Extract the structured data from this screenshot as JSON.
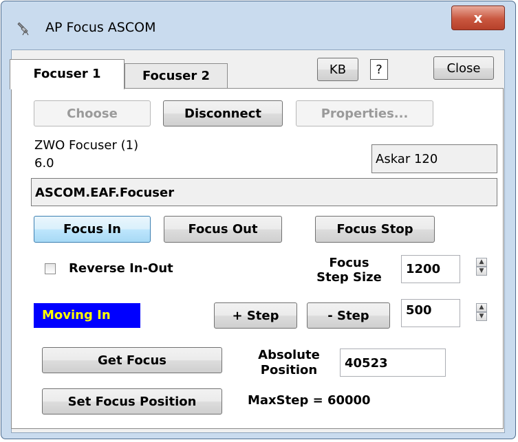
{
  "window": {
    "title": "AP Focus ASCOM",
    "close_glyph": "x"
  },
  "tabs": [
    {
      "label": "Focuser 1",
      "active": true
    },
    {
      "label": "Focuser 2",
      "active": false
    }
  ],
  "toolbar": {
    "kb_label": "KB",
    "help_label": "?",
    "close_label": "Close"
  },
  "connection": {
    "choose_label": "Choose",
    "disconnect_label": "Disconnect",
    "properties_label": "Properties...",
    "device_name": "ZWO Focuser (1)",
    "driver_version": "6.0",
    "telescope_name": "Askar 120",
    "driver_id": "ASCOM.EAF.Focuser"
  },
  "motion": {
    "focus_in_label": "Focus In",
    "focus_out_label": "Focus Out",
    "focus_stop_label": "Focus Stop"
  },
  "reverse": {
    "label": "Reverse In-Out",
    "checked": false
  },
  "step_size": {
    "label_line1": "Focus",
    "label_line2": "Step Size",
    "value": "1200"
  },
  "status": {
    "text": "Moving In",
    "bg_color": "#0000ff",
    "text_color": "#ffff00"
  },
  "stepping": {
    "plus_label": "+ Step",
    "minus_label": "- Step",
    "value": "500"
  },
  "position": {
    "get_focus_label": "Get Focus",
    "set_focus_label": "Set Focus Position",
    "abs_label_line1": "Absolute",
    "abs_label_line2": "Position",
    "abs_value": "40523",
    "max_step_text": "MaxStep = 60000"
  },
  "icons": {
    "app": "telescope-app-icon",
    "spin_up": "spin-up-arrow-icon",
    "spin_down": "spin-down-arrow-icon"
  }
}
